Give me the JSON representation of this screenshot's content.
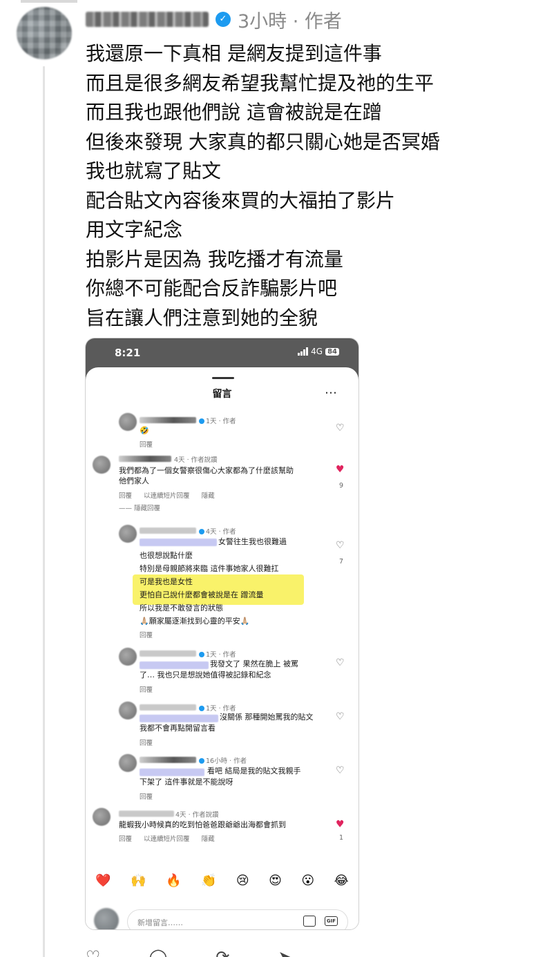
{
  "post": {
    "meta": "3小時 · 作者",
    "lines": [
      "我還原一下真相 是網友提到這件事",
      "而且是很多網友希望我幫忙提及祂的生平",
      "而且我也跟他們說 這會被說是在蹭",
      "但後來發現 大家真的都只關心她是否冥婚",
      "我也就寫了貼文",
      "配合貼文內容後來買的大福拍了影片",
      "用文字紀念",
      "拍影片是因為 我吃播才有流量",
      "你總不可能配合反詐騙影片吧",
      "旨在讓人們注意到她的全貌"
    ]
  },
  "screenshot": {
    "status_time": "8:21",
    "network": "4G",
    "battery": "84",
    "sheet_title": "留言",
    "more_icon": "…",
    "comments": [
      {
        "meta": "1天 · 作者",
        "text": [
          "🤣"
        ],
        "reply": [
          "回覆"
        ],
        "liked": false,
        "likes": ""
      },
      {
        "meta": "4天 · 作者說讚",
        "text": [
          "我們都為了一個女警察很傷心大家都為了什麼該幫助",
          "他們家人"
        ],
        "reply": [
          "回覆",
          "以連續短片回覆",
          "隱藏"
        ],
        "hidden_replies": "隱藏回覆",
        "liked": true,
        "likes": "9"
      },
      {
        "meta": "4天 · 作者",
        "text": [
          "女警往生我也很難過",
          "也很想說點什麼",
          "特別是母親節將來臨 這件事她家人很難扛",
          "可是我也是女性",
          "更怕自己說什麼都會被說是在 蹭流量",
          "所以我是不敢發言的狀態",
          "🙏🏼願家屬逐漸找到心靈的平安🙏🏼"
        ],
        "reply": [
          "回覆"
        ],
        "liked": false,
        "likes": "7"
      },
      {
        "meta": "1天 · 作者",
        "text": [
          "我發文了 果然在脆上 被罵",
          "了… 我也只是想說她值得被記錄和紀念"
        ],
        "reply": [
          "回覆"
        ],
        "liked": false,
        "likes": ""
      },
      {
        "meta": "1天 · 作者",
        "text": [
          "沒關係 那種開始罵我的貼文",
          "我都不會再點開留言看"
        ],
        "reply": [
          "回覆"
        ],
        "liked": false,
        "likes": ""
      },
      {
        "meta": "16小時 · 作者",
        "text": [
          "看吧 結局是我的貼文我親手",
          "下架了 這件事就是不能說呀"
        ],
        "reply": [
          "回覆"
        ],
        "liked": false,
        "likes": ""
      },
      {
        "meta": "4天 · 作者說讚",
        "text": [
          "龍蝦我小時候真的吃到怕爸爸跟爺爺出海都會抓到"
        ],
        "reply": [
          "回覆",
          "以連續短片回覆",
          "隱藏"
        ],
        "liked": true,
        "likes": "1"
      }
    ],
    "emojis": [
      "❤️",
      "🙌",
      "🔥",
      "👏",
      "😢",
      "😍",
      "😮",
      "😂"
    ],
    "input_placeholder": "新增留言……",
    "gif_label": "GIF"
  },
  "colors": {
    "verified": "#1d9bf0",
    "like": "#e0245e",
    "highlight": "#f9f26a"
  }
}
